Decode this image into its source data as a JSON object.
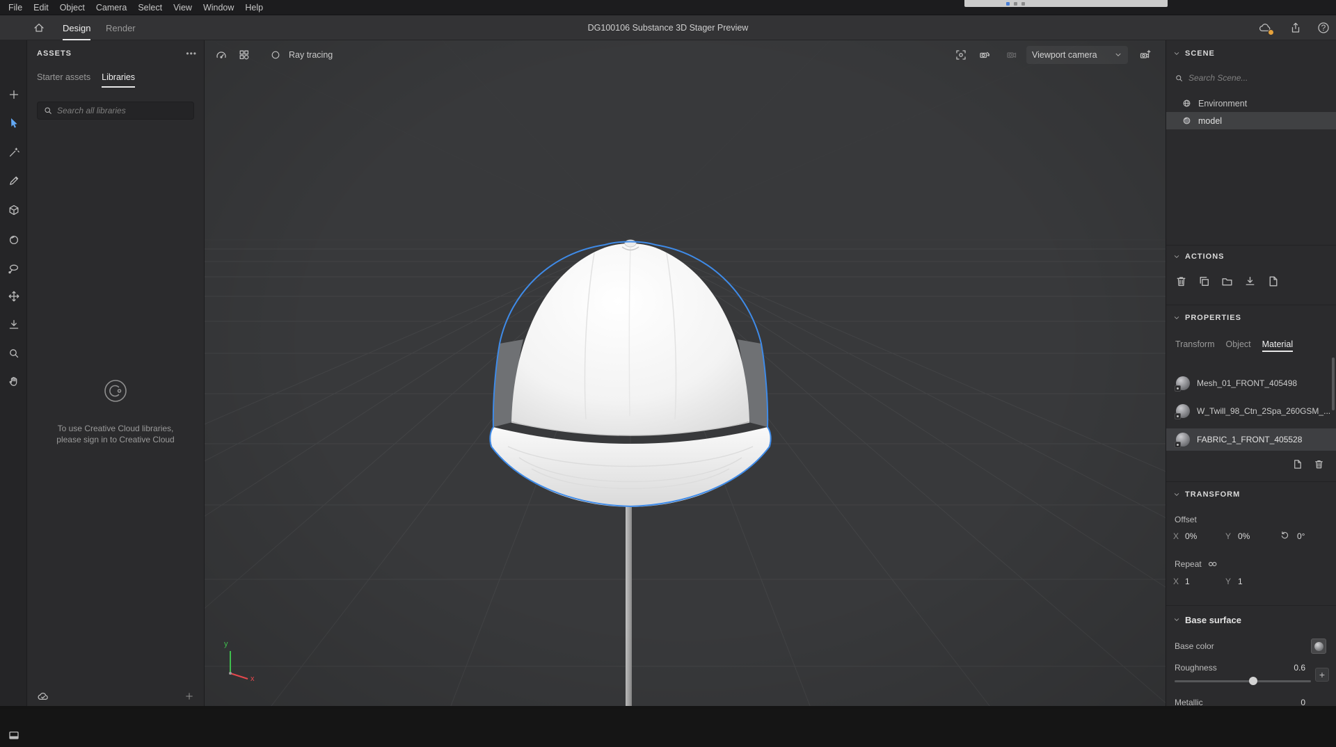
{
  "menu_bar": {
    "items": [
      "File",
      "Edit",
      "Object",
      "Camera",
      "Select",
      "View",
      "Window",
      "Help"
    ]
  },
  "header": {
    "tabs": [
      {
        "label": "Design"
      },
      {
        "label": "Render"
      }
    ],
    "title": "DG100106 Substance 3D Stager Preview",
    "help_glyph": "?"
  },
  "assets_panel": {
    "title": "ASSETS",
    "overflow_icon": "•••",
    "tabs": [
      {
        "label": "Starter assets"
      },
      {
        "label": "Libraries"
      }
    ],
    "search_placeholder": "Search all libraries",
    "cc_message_line1": "To use Creative Cloud libraries,",
    "cc_message_line2": "please sign in to Creative Cloud"
  },
  "viewport": {
    "ray_tracing_label": "Ray tracing",
    "camera_select_label": "Viewport camera",
    "axis_x_label": "x",
    "axis_y_label": "y"
  },
  "scene_panel": {
    "title": "SCENE",
    "search_placeholder": "Search Scene...",
    "items": [
      {
        "label": "Environment"
      },
      {
        "label": "model"
      }
    ]
  },
  "actions_panel": {
    "title": "ACTIONS"
  },
  "properties_panel": {
    "title": "PROPERTIES",
    "tabs": [
      {
        "label": "Transform"
      },
      {
        "label": "Object"
      },
      {
        "label": "Material"
      }
    ],
    "active_tab": "Material",
    "materials": [
      {
        "name": "Mesh_01_FRONT_405498"
      },
      {
        "name": "W_Twill_98_Ctn_2Spa_260GSM_..."
      },
      {
        "name": "FABRIC_1_FRONT_405528"
      }
    ]
  },
  "transform_section": {
    "title": "TRANSFORM",
    "offset_label": "Offset",
    "x_label": "X",
    "y_label": "Y",
    "offset_x_value": "0%",
    "offset_y_value": "0%",
    "rotation_value": "0°",
    "repeat_label": "Repeat",
    "repeat_x_value": "1",
    "repeat_y_value": "1"
  },
  "base_surface_section": {
    "title": "Base surface",
    "base_color_label": "Base color",
    "roughness_label": "Roughness",
    "roughness_value": "0.6",
    "metallic_label": "Metallic",
    "metallic_value": "0"
  },
  "colors": {
    "accent_blue": "#3a86e8",
    "selection_outline": "#3f8be8",
    "badge_orange": "#e6a23c"
  }
}
